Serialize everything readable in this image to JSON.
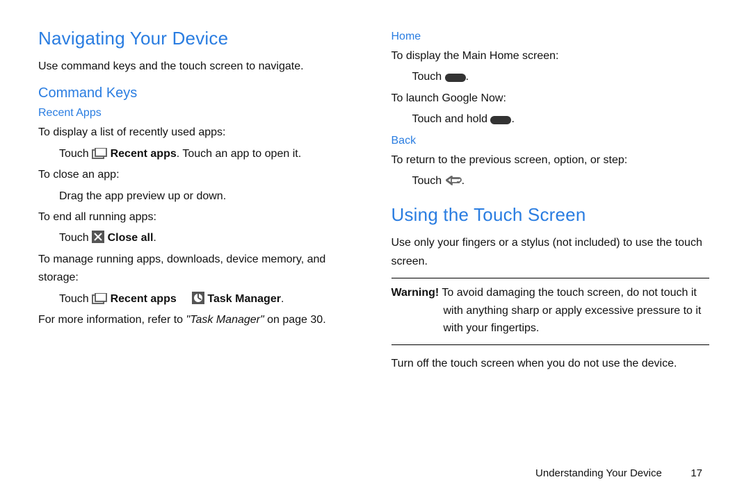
{
  "left": {
    "h1": "Navigating Your Device",
    "intro": "Use command keys and the touch screen to navigate.",
    "h2_command_keys": "Command Keys",
    "h3_recent_apps": "Recent Apps",
    "ra_intro": "To display a list of recently used apps:",
    "ra_touch_prefix": "Touch ",
    "ra_recent_label": "Recent apps",
    "ra_touch_suffix": ". Touch an app to open it.",
    "close_intro": "To close an app:",
    "close_action": "Drag the app preview up or down.",
    "end_intro": "To end all running apps:",
    "end_touch_prefix": "Touch ",
    "end_close_all": "Close all",
    "end_period": ".",
    "manage_intro": "To manage running apps, downloads, device memory, and storage:",
    "manage_touch_prefix": "Touch ",
    "manage_recent": "Recent apps",
    "manage_arrow_gap": " ",
    "manage_task_mgr": "Task Manager",
    "manage_period": ".",
    "xref_prefix": "For more information, refer to ",
    "xref_title": "\"Task Manager\"",
    "xref_suffix": " on page 30."
  },
  "right": {
    "h3_home": "Home",
    "home_intro": "To display the Main Home screen:",
    "home_touch_prefix": "Touch ",
    "home_touch_period": ".",
    "gnow_intro": "To launch Google Now:",
    "gnow_action_prefix": "Touch and hold ",
    "gnow_action_period": ".",
    "h3_back": "Back",
    "back_intro": "To return to the previous screen, option, or step:",
    "back_touch_prefix": "Touch ",
    "back_touch_period": ".",
    "h1_touchscreen": "Using the Touch Screen",
    "ts_intro": "Use only your fingers or a stylus (not included) to use the touch screen.",
    "warning_label": "Warning!",
    "warning_body": " To avoid damaging the touch screen, do not touch it with anything sharp or apply excessive pressure to it with your fingertips.",
    "ts_note": "Turn off the touch screen when you do not use the device."
  },
  "footer": {
    "section": "Understanding Your Device",
    "page": "17"
  }
}
